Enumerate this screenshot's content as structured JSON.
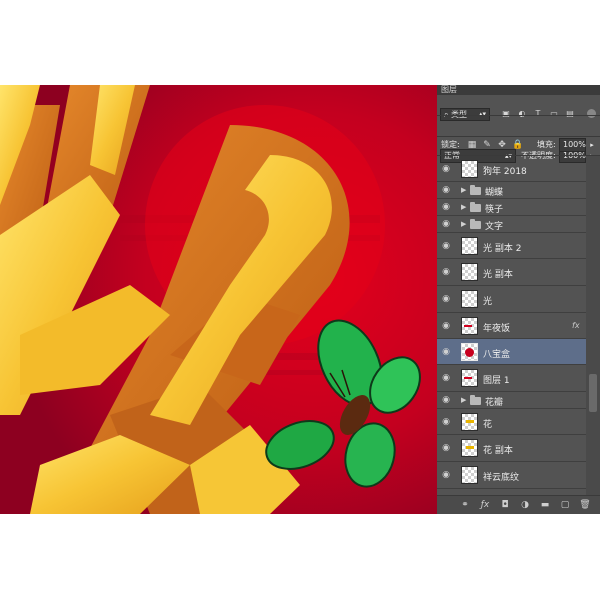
{
  "panel": {
    "tab_label": "图层",
    "filter_label": "类型",
    "filter_icons": [
      "image-filter-icon",
      "adjustment-filter-icon",
      "text-filter-icon",
      "shape-filter-icon",
      "smart-object-filter-icon"
    ],
    "blend_mode": "正常",
    "opacity_label": "不透明度:",
    "opacity_value": "100%",
    "lock_label": "锁定:",
    "fill_label": "填充:",
    "fill_value": "100%"
  },
  "layers": [
    {
      "name": "狗年 2018",
      "kind": "layer"
    },
    {
      "name": "蝴蝶",
      "kind": "group"
    },
    {
      "name": "筷子",
      "kind": "group"
    },
    {
      "name": "文字",
      "kind": "group"
    },
    {
      "name": "光 副本 2",
      "kind": "layer"
    },
    {
      "name": "光 副本",
      "kind": "layer"
    },
    {
      "name": "光",
      "kind": "layer"
    },
    {
      "name": "年夜饭",
      "kind": "layer",
      "fx": "fx"
    },
    {
      "name": "八宝盒",
      "kind": "layer",
      "selected": true
    },
    {
      "name": "图层 1",
      "kind": "layer"
    },
    {
      "name": "花瓣",
      "kind": "group"
    },
    {
      "name": "花",
      "kind": "layer"
    },
    {
      "name": "花 副本",
      "kind": "layer"
    },
    {
      "name": "祥云底纹",
      "kind": "layer"
    }
  ],
  "bottom_icons": [
    "link-icon",
    "fx-icon",
    "mask-icon",
    "adjustment-icon",
    "group-icon",
    "new-layer-icon",
    "trash-icon"
  ],
  "colors": {
    "canvas_red": "#c4001f",
    "gold": "#f5c230",
    "orange": "#d3741f",
    "butterfly_green": "#22b24c",
    "panel_bg": "#535353",
    "selected_row": "#5e6e8a"
  }
}
